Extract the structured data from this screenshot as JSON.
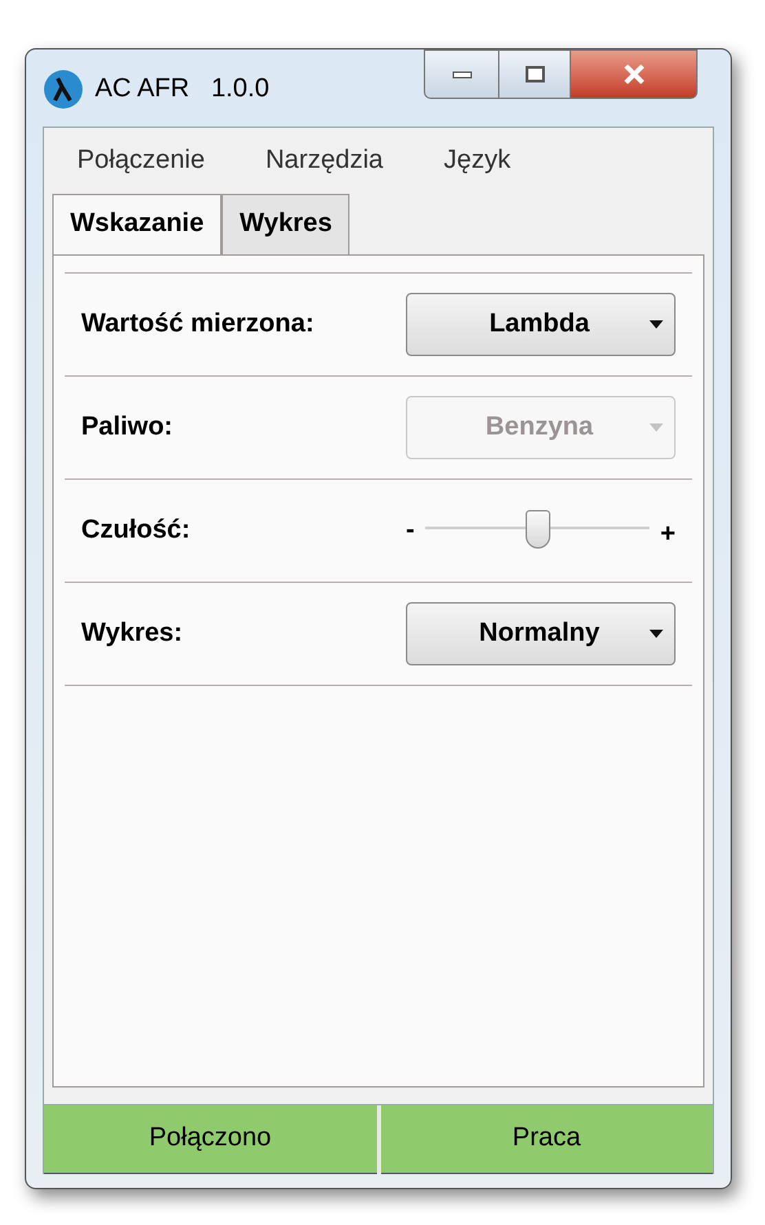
{
  "window": {
    "title": "AC AFR   1.0.0"
  },
  "menu": [
    "Połączenie",
    "Narzędzia",
    "Język"
  ],
  "tabs": [
    {
      "label": "Wskazanie",
      "selected": true
    },
    {
      "label": "Wykres",
      "selected": false
    }
  ],
  "settings": [
    {
      "kind": "dropdown",
      "label": "Wartość mierzona:",
      "value": "Lambda",
      "disabled": false
    },
    {
      "kind": "dropdown",
      "label": "Paliwo:",
      "value": "Benzyna",
      "disabled": true
    },
    {
      "kind": "slider",
      "label": "Czułość:",
      "min_label": "-",
      "max_label": "+",
      "level": 0.5
    },
    {
      "kind": "dropdown",
      "label": "Wykres:",
      "value": "Normalny",
      "disabled": false
    }
  ],
  "status_bar": [
    {
      "text": "Połączono",
      "color": "#8fca6c"
    },
    {
      "text": "Praca",
      "color": "#8fca6c"
    }
  ]
}
